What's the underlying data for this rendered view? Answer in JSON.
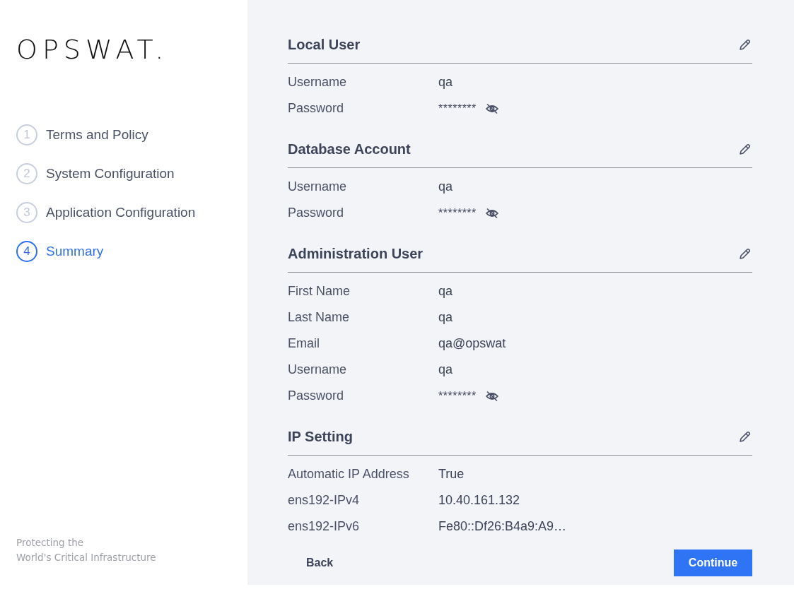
{
  "brand": {
    "logo": "OPSWAT.",
    "tagline_lines": [
      "Protecting the",
      "World's Critical Infrastructure"
    ]
  },
  "steps": [
    {
      "number": "1",
      "label": "Terms and Policy",
      "selected": false
    },
    {
      "number": "2",
      "label": "System Configuration",
      "selected": false
    },
    {
      "number": "3",
      "label": "Application Configuration",
      "selected": false
    },
    {
      "number": "4",
      "label": "Summary",
      "selected": true
    }
  ],
  "sections": [
    {
      "title": "Local User",
      "rows": [
        {
          "kind": "text",
          "label": "Username",
          "value": "qa"
        },
        {
          "kind": "password",
          "label": "Password",
          "value": "********"
        }
      ]
    },
    {
      "title": "Database Account",
      "rows": [
        {
          "kind": "text",
          "label": "Username",
          "value": "qa"
        },
        {
          "kind": "password",
          "label": "Password",
          "value": "********"
        }
      ]
    },
    {
      "title": "Administration User",
      "rows": [
        {
          "kind": "text",
          "label": "First Name",
          "value": "qa"
        },
        {
          "kind": "text",
          "label": "Last Name",
          "value": "qa"
        },
        {
          "kind": "text",
          "label": "Email",
          "value": "qa@opswat"
        },
        {
          "kind": "text",
          "label": "Username",
          "value": "qa"
        },
        {
          "kind": "password",
          "label": "Password",
          "value": "********"
        }
      ]
    },
    {
      "title": "IP Setting",
      "rows": [
        {
          "kind": "text",
          "label": "Automatic IP Address",
          "value": "True"
        },
        {
          "kind": "text",
          "label": "ens192-IPv4",
          "value": "10.40.161.132"
        },
        {
          "kind": "text",
          "label": "ens192-IPv6",
          "value": "Fe80::Df26:B4a9:A9…"
        }
      ]
    }
  ],
  "buttons": {
    "back": "Back",
    "continue": "Continue"
  }
}
